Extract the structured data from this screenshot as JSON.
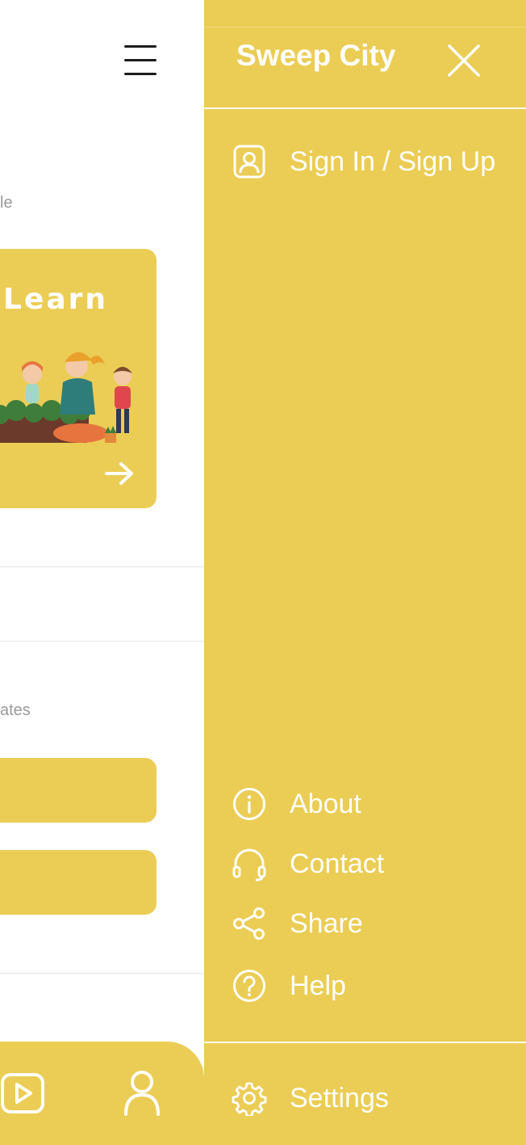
{
  "colors": {
    "accent": "#ebcd55",
    "drawer_text": "#ffffff",
    "muted_text": "#9a9a9a"
  },
  "background_page": {
    "partial_label_1": "le",
    "learn_card": {
      "title": "Learn",
      "arrow_icon": "arrow-right-icon"
    },
    "partial_label_2": "ates",
    "bottom_nav": {
      "icons": [
        "play-icon",
        "user-icon"
      ]
    }
  },
  "drawer": {
    "title": "Sweep City",
    "close_icon": "close-icon",
    "sign_in": {
      "label": "Sign In / Sign Up",
      "icon": "user-badge-icon"
    },
    "menu_items": [
      {
        "label": "About",
        "icon": "info-icon"
      },
      {
        "label": "Contact",
        "icon": "headset-icon"
      },
      {
        "label": "Share",
        "icon": "share-icon"
      },
      {
        "label": "Help",
        "icon": "help-icon"
      }
    ],
    "settings": {
      "label": "Settings",
      "icon": "gear-icon"
    }
  }
}
